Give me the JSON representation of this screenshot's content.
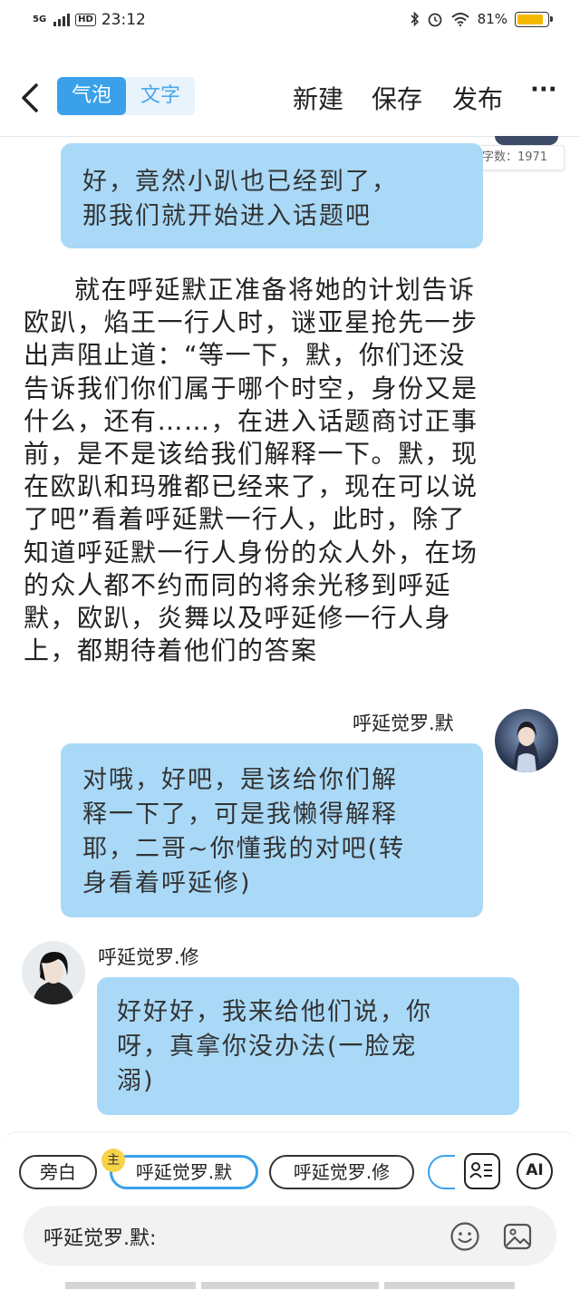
{
  "status_bar": {
    "signal_label": "5G",
    "hd_label": "HD",
    "time": "23:12",
    "battery": "81%",
    "battery_level": 0.81
  },
  "nav": {
    "tab_bubble": "气泡",
    "tab_text": "文字",
    "new": "新建",
    "save": "保存",
    "publish": "发布",
    "more": "···"
  },
  "word_count": "字数：1971",
  "messages": {
    "m1": [
      "好，竟然小趴也已经到了，",
      "那我们就开始进入话题吧"
    ],
    "narration": [
      "就在呼延默正准备将她的计划告诉",
      "欧趴，焰王一行人时，谜亚星抢先一步",
      "出声阻止道：“等一下，默，你们还没",
      "告诉我们你们属于哪个时空，身份又是",
      "什么，还有……，在进入话题商讨正事",
      "前，是不是该给我们解释一下。默，现",
      "在欧趴和玛雅都已经来了，现在可以说",
      "了吧”看着呼延默一行人，此时，除了",
      "知道呼延默一行人身份的众人外，在场",
      "的众人都不约而同的将余光移到呼延",
      "默，欧趴，炎舞以及呼延修一行人身",
      "上，都期待着他们的答案"
    ],
    "m2_name": "呼延觉罗.默",
    "m2": [
      "对哦，好吧，是该给你们解",
      "释一下了，可是我懒得解释",
      "耶，二哥~你懂我的对吧(转",
      "身看着呼延修)"
    ],
    "m3_name": "呼延觉罗.修",
    "m3": [
      "好好好，我来给他们说，你",
      "呀，真拿你没办法(一脸宠",
      "溺)"
    ]
  },
  "bottom": {
    "chip_narrator": "旁白",
    "host_badge": "主",
    "chip_mo": "呼延觉罗.默",
    "chip_xiu": "呼延觉罗.修",
    "ai_label": "AI",
    "input_text": "呼延觉罗.默:"
  }
}
